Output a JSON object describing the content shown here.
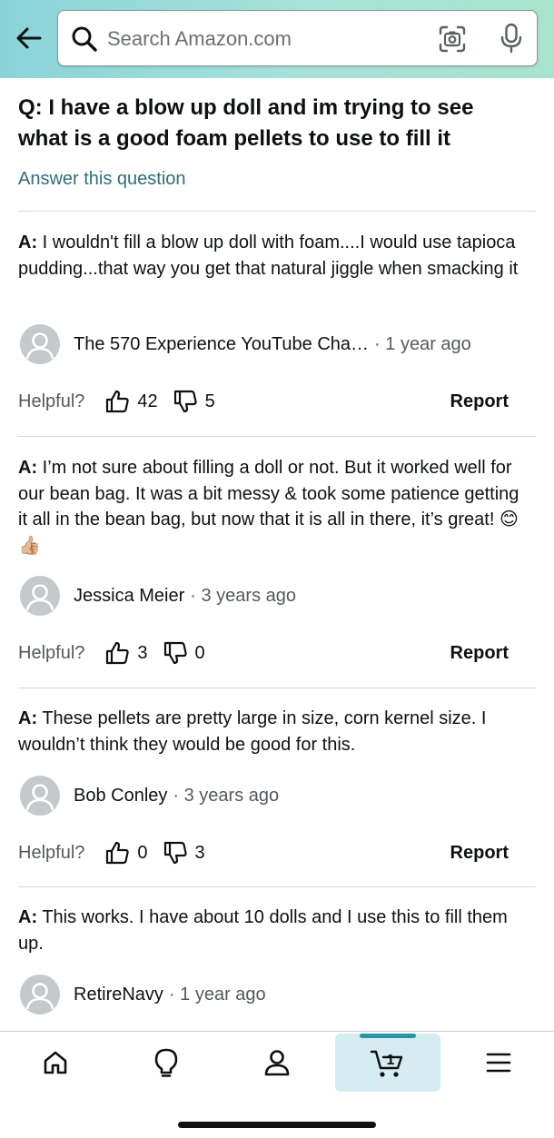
{
  "search": {
    "placeholder": "Search Amazon.com"
  },
  "question": {
    "prefix": "Q:",
    "text": "I have a blow up doll and im trying to see what is a good foam pellets to use to fill it"
  },
  "answer_link": "Answer this question",
  "answers": [
    {
      "prefix": "A:",
      "text": "I wouldn't fill a blow up doll with foam....I would use tapioca pudding...that way you get that natural jiggle when smacking it",
      "author": "The 570 Experience YouTube Cha…",
      "time": "· 1 year ago",
      "helpful_label": "Helpful?",
      "up": "42",
      "down": "5",
      "report": "Report"
    },
    {
      "prefix": "A:",
      "text": "I’m not sure about filling a doll or not. But it worked well for our bean bag. It was a bit messy & took some patience getting it all in the bean bag, but now that it is all in there, it’s great! 😊👍🏼",
      "author": "Jessica Meier",
      "time": "· 3 years ago",
      "helpful_label": "Helpful?",
      "up": "3",
      "down": "0",
      "report": "Report"
    },
    {
      "prefix": "A:",
      "text": "These pellets are pretty large in size, corn kernel size. I wouldn’t think they would be good for this.",
      "author": "Bob Conley",
      "time": "· 3 years ago",
      "helpful_label": "Helpful?",
      "up": "0",
      "down": "3",
      "report": "Report"
    },
    {
      "prefix": "A:",
      "text": "This works. I have about 10 dolls and I use this to fill them up.",
      "author": "RetireNavy",
      "time": "· 1 year ago"
    }
  ],
  "nav": {
    "items": [
      "home-icon",
      "lightbulb-icon",
      "profile-icon",
      "cart-icon",
      "menu-icon"
    ],
    "cart_count": "1",
    "active": "cart"
  },
  "colors": {
    "link": "#2e6e7a",
    "header_start": "#8ad4d9",
    "header_end": "#a8e3cd",
    "nav_active": "#d5ecf0",
    "nav_indicator": "#2e93a8"
  }
}
